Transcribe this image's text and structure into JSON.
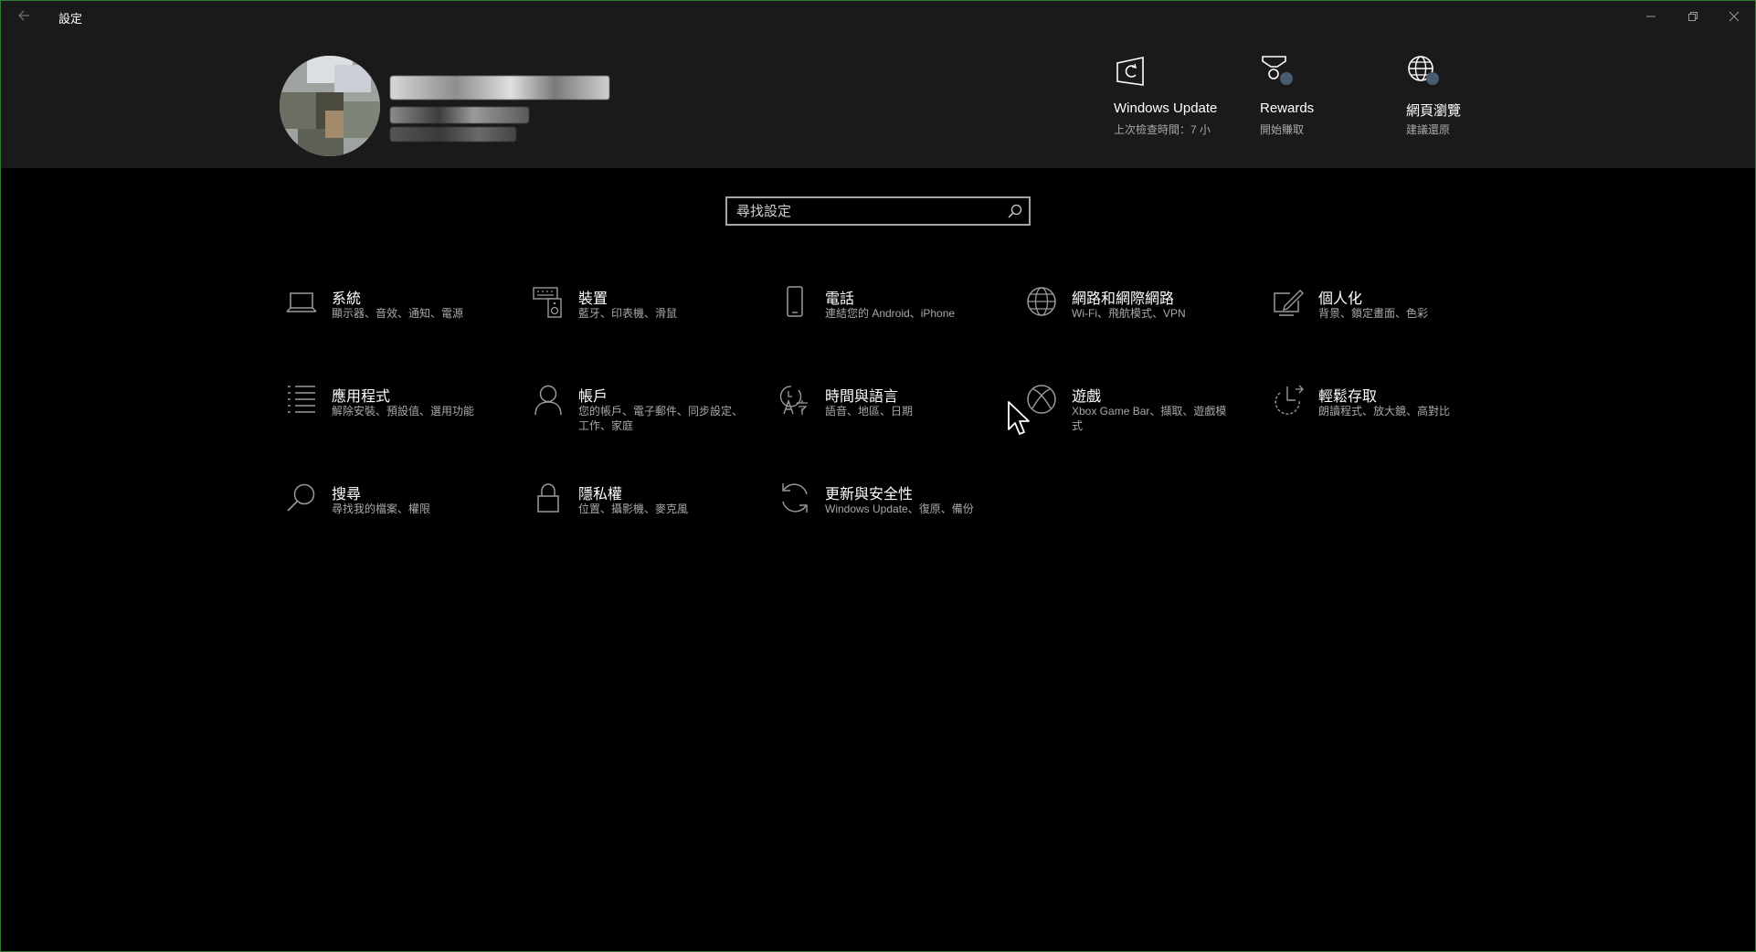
{
  "window": {
    "title": "設定",
    "back_icon": "back-arrow-icon",
    "controls": [
      "minimize-icon",
      "restore-icon",
      "close-icon"
    ]
  },
  "account": {
    "avatar_icon": "user-avatar",
    "name": "",
    "email": "",
    "extra": ""
  },
  "quick_links": [
    {
      "title": "Windows Update",
      "subtitle": "上次檢查時間：7 小",
      "icon": "windows-update-icon"
    },
    {
      "title": "Rewards",
      "subtitle": "開始賺取",
      "icon": "rewards-icon"
    },
    {
      "title": "網頁瀏覽",
      "subtitle": "建議還原",
      "icon": "web-browsing-icon"
    }
  ],
  "search": {
    "placeholder": "尋找設定",
    "value": ""
  },
  "categories": [
    {
      "title": "系統",
      "subtitle": "顯示器、音效、通知、電源",
      "icon": "laptop-icon"
    },
    {
      "title": "裝置",
      "subtitle": "藍牙、印表機、滑鼠",
      "icon": "devices-icon"
    },
    {
      "title": "電話",
      "subtitle": "連結您的 Android、iPhone",
      "icon": "phone-icon"
    },
    {
      "title": "網路和網際網路",
      "subtitle": "Wi-Fi、飛航模式、VPN",
      "icon": "globe-icon"
    },
    {
      "title": "個人化",
      "subtitle": "背景、鎖定畫面、色彩",
      "icon": "personalization-icon"
    },
    {
      "title": "應用程式",
      "subtitle": "解除安裝、預設值、選用功能",
      "icon": "apps-list-icon"
    },
    {
      "title": "帳戶",
      "subtitle": "您的帳戶、電子郵件、同步設定、工作、家庭",
      "icon": "person-icon"
    },
    {
      "title": "時間與語言",
      "subtitle": "語音、地區、日期",
      "icon": "time-language-icon"
    },
    {
      "title": "遊戲",
      "subtitle": "Xbox Game Bar、擷取、遊戲模式",
      "icon": "xbox-icon"
    },
    {
      "title": "輕鬆存取",
      "subtitle": "朗讀程式、放大鏡、高對比",
      "icon": "ease-of-access-icon"
    },
    {
      "title": "搜尋",
      "subtitle": "尋找我的檔案、權限",
      "icon": "search-icon"
    },
    {
      "title": "隱私權",
      "subtitle": "位置、攝影機、麥克風",
      "icon": "lock-icon"
    },
    {
      "title": "更新與安全性",
      "subtitle": "Windows Update、復原、備份",
      "icon": "sync-icon"
    }
  ],
  "colors": {
    "background": "#000000",
    "header": "#1a1a1a",
    "text": "#ffffff",
    "subtext": "#a8a8a8",
    "icon": "#9a9a9a",
    "window_border": "#2f7d32",
    "badge": "#4a5a70"
  }
}
